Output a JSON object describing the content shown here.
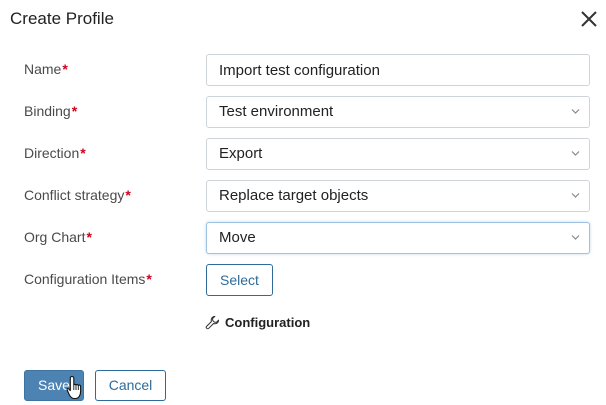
{
  "dialog": {
    "title": "Create Profile",
    "close_icon": "close-icon"
  },
  "form": {
    "required_marker": "*",
    "name": {
      "label": "Name",
      "value": "Import test configuration"
    },
    "binding": {
      "label": "Binding",
      "value": "Test environment"
    },
    "direction": {
      "label": "Direction",
      "value": "Export"
    },
    "conflict_strategy": {
      "label": "Conflict strategy",
      "value": "Replace target objects"
    },
    "org_chart": {
      "label": "Org Chart",
      "value": "Move"
    },
    "configuration_items": {
      "label": "Configuration Items",
      "select_label": "Select"
    },
    "configuration_link": {
      "label": "Configuration",
      "icon": "wrench-icon"
    }
  },
  "actions": {
    "save_label": "Save",
    "cancel_label": "Cancel"
  },
  "colors": {
    "accent": "#2f6b9a",
    "primary_button": "#4d83b3",
    "required": "#d0021b",
    "border": "#cfd4d9"
  }
}
